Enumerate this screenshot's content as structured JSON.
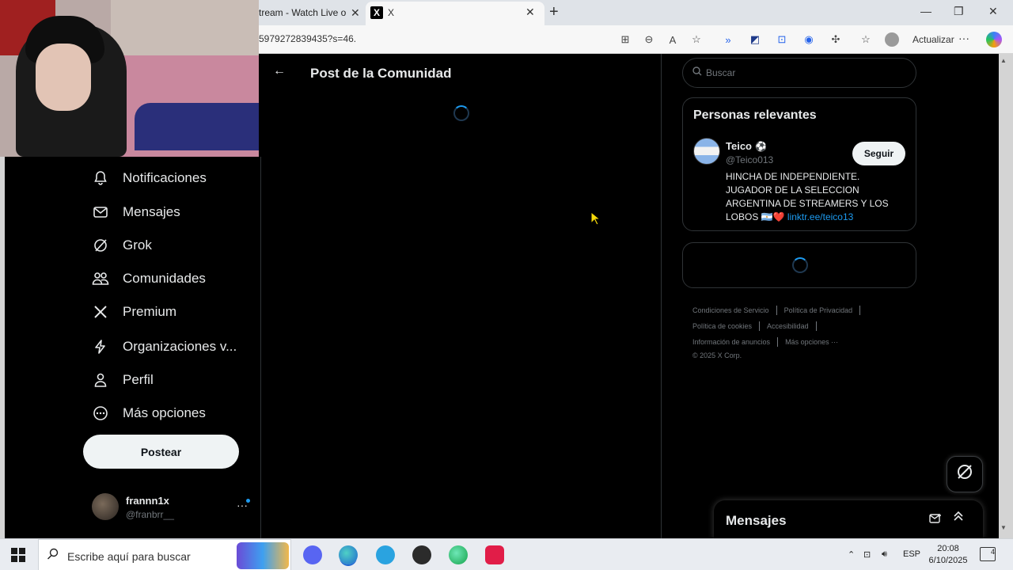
{
  "browser": {
    "tabs": [
      {
        "title": "tream - Watch Live on",
        "close": "✕"
      },
      {
        "title": "X",
        "favicon": "X",
        "close": "✕"
      }
    ],
    "new_tab": "+",
    "window_controls": {
      "minimize": "—",
      "restore": "❐",
      "close": "✕"
    },
    "url": "5979272839435?s=46.",
    "update_label": "Actualizar",
    "more_label": "···"
  },
  "nav": {
    "items": [
      {
        "label": "Notificaciones",
        "icon": "bell-icon"
      },
      {
        "label": "Mensajes",
        "icon": "envelope-icon"
      },
      {
        "label": "Grok",
        "icon": "grok-icon"
      },
      {
        "label": "Comunidades",
        "icon": "people-icon"
      },
      {
        "label": "Premium",
        "icon": "x-logo-icon"
      },
      {
        "label": "Organizaciones v...",
        "icon": "lightning-icon"
      },
      {
        "label": "Perfil",
        "icon": "person-icon"
      },
      {
        "label": "Más opciones",
        "icon": "more-circle-icon"
      }
    ],
    "post_label": "Postear",
    "user": {
      "name": "frannn1x",
      "handle": "@franbrr__",
      "more": "···"
    }
  },
  "main": {
    "title": "Post de la Comunidad",
    "back": "←"
  },
  "right": {
    "search_placeholder": "Buscar",
    "relevant": {
      "title": "Personas relevantes",
      "name": "Teico",
      "badge": "⚽",
      "handle": "@Teico013",
      "follow_label": "Seguir",
      "bio": "HINCHA DE INDEPENDIENTE. JUGADOR DE LA SELECCION ARGENTINA DE STREAMERS Y LOS LOBOS 🇦🇷❤️",
      "link": "linktr.ee/teico13"
    },
    "footer": {
      "row1": [
        "Condiciones de Servicio",
        "Política de Privacidad"
      ],
      "row2": [
        "Política de cookies",
        "Accesibilidad"
      ],
      "row3": [
        "Información de anuncios",
        "Más opciones ···"
      ],
      "copyright": "© 2025 X Corp."
    },
    "messages_label": "Mensajes"
  },
  "taskbar": {
    "search_placeholder": "Escribe aquí para buscar",
    "lang": "ESP",
    "time": "20:08",
    "date": "6/10/2025",
    "notif_count": "4"
  },
  "colors": {
    "accent": "#1d9bf0",
    "background": "#000000",
    "border": "#2f3336",
    "muted_text": "#71767b"
  }
}
